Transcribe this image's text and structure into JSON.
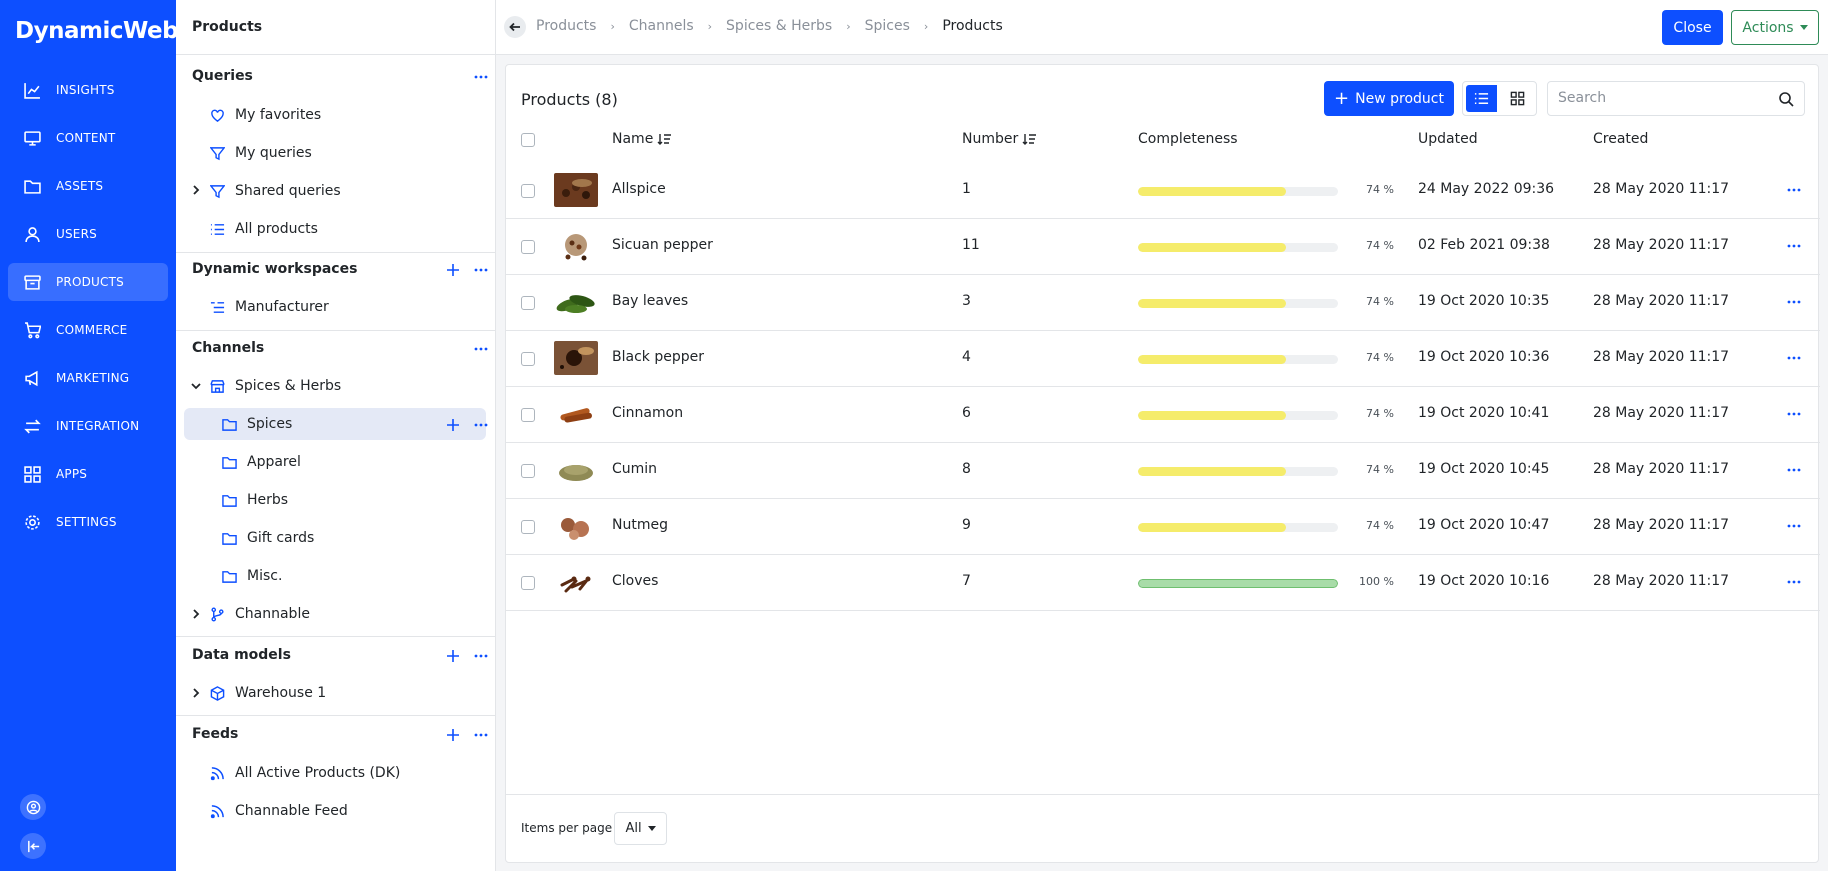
{
  "app": {
    "logo": "DynamicWeb"
  },
  "nav": {
    "items": [
      {
        "label": "INSIGHTS",
        "icon": "chart-line-icon"
      },
      {
        "label": "CONTENT",
        "icon": "monitor-icon"
      },
      {
        "label": "ASSETS",
        "icon": "folder-icon"
      },
      {
        "label": "USERS",
        "icon": "user-icon"
      },
      {
        "label": "PRODUCTS",
        "icon": "archive-box-icon",
        "active": true
      },
      {
        "label": "COMMERCE",
        "icon": "cart-icon"
      },
      {
        "label": "MARKETING",
        "icon": "megaphone-icon"
      },
      {
        "label": "INTEGRATION",
        "icon": "arrows-exchange-icon"
      },
      {
        "label": "APPS",
        "icon": "grid-icon"
      },
      {
        "label": "SETTINGS",
        "icon": "gear-icon"
      }
    ]
  },
  "tree": {
    "title": "Products",
    "queries": {
      "title": "Queries",
      "items": [
        "My favorites",
        "My queries",
        "Shared queries",
        "All products"
      ]
    },
    "workspaces": {
      "title": "Dynamic workspaces",
      "items": [
        "Manufacturer"
      ]
    },
    "channels": {
      "title": "Channels",
      "items": [
        "Spices & Herbs",
        "Spices",
        "Apparel",
        "Herbs",
        "Gift cards",
        "Misc.",
        "Channable"
      ]
    },
    "datamodels": {
      "title": "Data models",
      "items": [
        "Warehouse 1"
      ]
    },
    "feeds": {
      "title": "Feeds",
      "items": [
        "All Active Products (DK)",
        "Channable Feed"
      ]
    }
  },
  "breadcrumb": [
    "Products",
    "Channels",
    "Spices & Herbs",
    "Spices",
    "Products"
  ],
  "header": {
    "close_label": "Close",
    "actions_label": "Actions"
  },
  "list": {
    "title": "Products (8)",
    "new_label": "New product",
    "search_placeholder": "Search",
    "columns": {
      "name": "Name",
      "number": "Number",
      "completeness": "Completeness",
      "updated": "Updated",
      "created": "Created"
    },
    "rows": [
      {
        "name": "Allspice",
        "number": "1",
        "completeness": 74,
        "pct": "74 %",
        "updated": "24 May 2022 09:36",
        "created": "28 May 2020 11:17"
      },
      {
        "name": "Sicuan pepper",
        "number": "11",
        "completeness": 74,
        "pct": "74 %",
        "updated": "02 Feb 2021 09:38",
        "created": "28 May 2020 11:17"
      },
      {
        "name": "Bay leaves",
        "number": "3",
        "completeness": 74,
        "pct": "74 %",
        "updated": "19 Oct 2020 10:35",
        "created": "28 May 2020 11:17"
      },
      {
        "name": "Black pepper",
        "number": "4",
        "completeness": 74,
        "pct": "74 %",
        "updated": "19 Oct 2020 10:36",
        "created": "28 May 2020 11:17"
      },
      {
        "name": "Cinnamon",
        "number": "6",
        "completeness": 74,
        "pct": "74 %",
        "updated": "19 Oct 2020 10:41",
        "created": "28 May 2020 11:17"
      },
      {
        "name": "Cumin",
        "number": "8",
        "completeness": 74,
        "pct": "74 %",
        "updated": "19 Oct 2020 10:45",
        "created": "28 May 2020 11:17"
      },
      {
        "name": "Nutmeg",
        "number": "9",
        "completeness": 74,
        "pct": "74 %",
        "updated": "19 Oct 2020 10:47",
        "created": "28 May 2020 11:17"
      },
      {
        "name": "Cloves",
        "number": "7",
        "completeness": 100,
        "pct": "100 %",
        "updated": "19 Oct 2020 10:16",
        "created": "28 May 2020 11:17"
      }
    ],
    "items_per_page_label": "Items per page",
    "items_per_page_value": "All"
  },
  "colors": {
    "brand": "#0d4fff",
    "partial_bar": "#f5ec6b",
    "complete_bar": "#a8dca8",
    "actions_green": "#2e8b57"
  }
}
